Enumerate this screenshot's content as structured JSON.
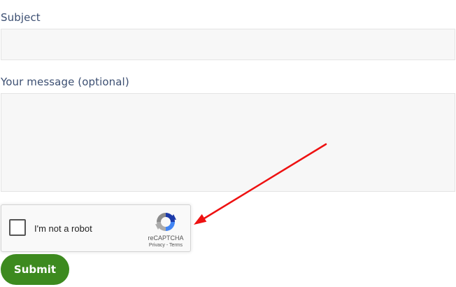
{
  "form": {
    "subject_label": "Subject",
    "subject_value": "",
    "message_label": "Your message (optional)",
    "message_value": "",
    "submit_label": "Submit"
  },
  "recaptcha": {
    "checkbox_label": "I'm not a robot",
    "checked": false,
    "brand": "reCAPTCHA",
    "privacy_link": "Privacy",
    "separator": "-",
    "terms_link": "Terms",
    "logo_icon": "recaptcha-logo-icon"
  },
  "annotation": {
    "icon": "red-arrow-icon",
    "color": "#ee1111"
  },
  "colors": {
    "label": "#3c4f72",
    "field_background": "#f7f7f7",
    "field_border": "#e4e4e4",
    "submit_background": "#3d8a1f",
    "submit_text": "#ffffff"
  }
}
